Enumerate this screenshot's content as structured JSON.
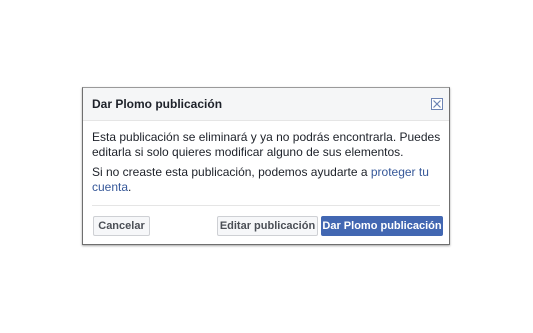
{
  "dialog": {
    "title": "Dar Plomo publicación",
    "close_icon": "close-icon",
    "message_line": "Esta publicación se eliminará y ya no podrás encontrarla. Puedes editarla si solo quieres modificar alguno de sus elementos.",
    "help_text": "Si no creaste esta publicación, podemos ayudarte a ",
    "help_link": "proteger tu cuenta",
    "help_end": "."
  },
  "buttons": {
    "cancel": "Cancelar",
    "edit": "Editar publicación",
    "confirm": "Dar Plomo publicación"
  },
  "colors": {
    "primary": "#4267b2",
    "link": "#365899",
    "text": "#1d2129"
  }
}
